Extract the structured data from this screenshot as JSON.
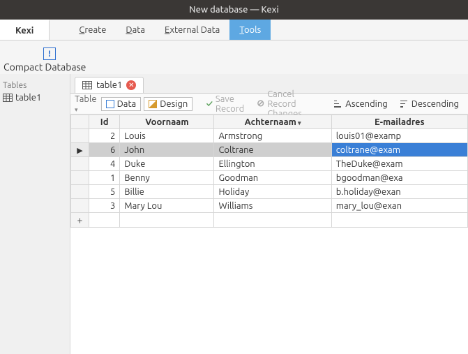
{
  "window": {
    "title": "New database — Kexi"
  },
  "app_tab": "Kexi",
  "menu": {
    "create": "Create",
    "data": "Data",
    "external": "External Data",
    "tools": "Tools"
  },
  "compact_db": "Compact Database",
  "sidebar": {
    "title": "Tables",
    "items": [
      {
        "label": "table1"
      }
    ]
  },
  "doc_tab": {
    "label": "table1"
  },
  "table_toolbar": {
    "label": "Table",
    "data_btn": "Data",
    "design_btn": "Design",
    "save": "Save Record",
    "cancel": "Cancel Record Changes",
    "asc": "Ascending",
    "desc": "Descending"
  },
  "grid": {
    "columns": [
      "Id",
      "Voornaam",
      "Achternaam",
      "E-mailadres"
    ],
    "sorted_col_index": 2,
    "selected_col_index": 3,
    "selected_row_index": 1,
    "rows": [
      {
        "id": 2,
        "first": "Louis",
        "last": "Armstrong",
        "email": "louis01@examp"
      },
      {
        "id": 6,
        "first": "John",
        "last": "Coltrane",
        "email": "coltrane@exam"
      },
      {
        "id": 4,
        "first": "Duke",
        "last": "Ellington",
        "email": "TheDuke@exam"
      },
      {
        "id": 1,
        "first": "Benny",
        "last": "Goodman",
        "email": "bgoodman@exa"
      },
      {
        "id": 5,
        "first": "Billie",
        "last": "Holiday",
        "email": "b.holiday@exan"
      },
      {
        "id": 3,
        "first": "Mary Lou",
        "last": "Williams",
        "email": "mary_lou@exan"
      }
    ]
  }
}
